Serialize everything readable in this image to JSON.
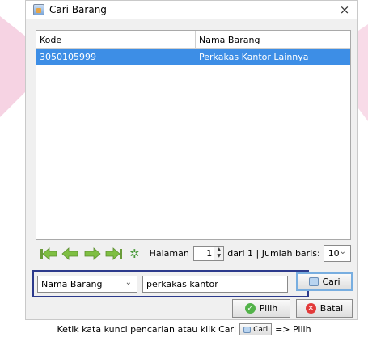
{
  "window": {
    "title": "Cari Barang",
    "close_glyph": "×",
    "app_icon": "java-app-icon"
  },
  "table": {
    "columns": [
      "Kode",
      "Nama Barang"
    ],
    "rows": [
      {
        "kode": "3050105999",
        "nama": "Perkakas Kantor Lainnya",
        "selected": true
      }
    ],
    "selection_color": "#3d8ee6"
  },
  "pager": {
    "nav_icons": [
      "first-page-icon",
      "prev-page-icon",
      "next-page-icon",
      "last-page-icon",
      "refresh-icon"
    ],
    "page_label": "Halaman",
    "page_value": "1",
    "of_text": "dari 1  | Jumlah baris:",
    "rows_value": "10"
  },
  "search": {
    "field_selected": "Nama Barang",
    "query": "perkakas kantor",
    "highlight_color": "#2c3a8c"
  },
  "buttons": {
    "cari": "Cari",
    "pilih": "Pilih",
    "batal": "Batal"
  },
  "caption": {
    "before": "Ketik kata kunci pencarian atau klik Cari",
    "button": "Cari",
    "after": "=> Pilih"
  }
}
